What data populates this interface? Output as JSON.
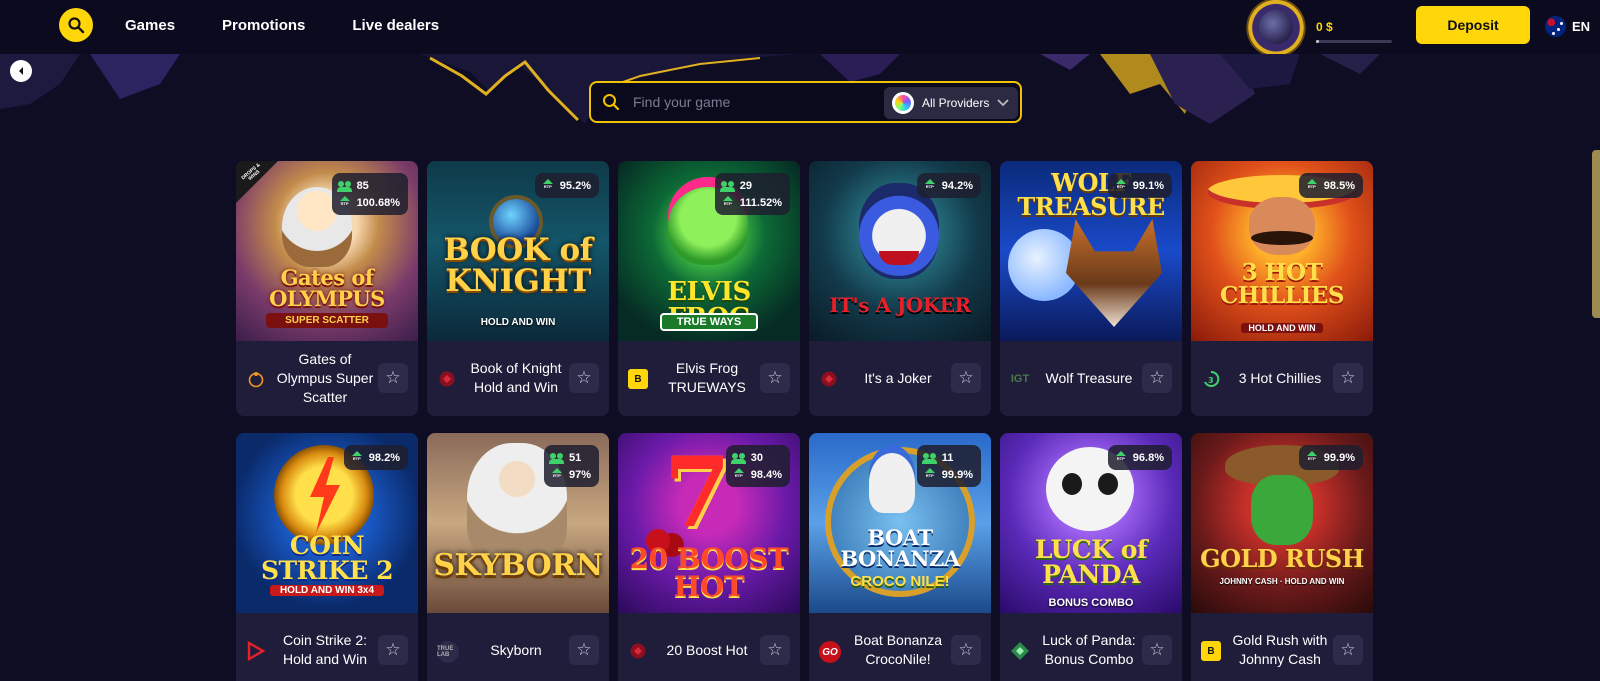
{
  "nav": {
    "items": [
      "Games",
      "Promotions",
      "Live dealers"
    ]
  },
  "account": {
    "balance": "0 $",
    "deposit_label": "Deposit",
    "language": "EN"
  },
  "search": {
    "placeholder": "Find your game",
    "providers_label": "All Providers"
  },
  "colors": {
    "accent": "#ffd60a",
    "background": "#0e0d24",
    "card": "#1f1d3a",
    "stat_green": "#3fd26b"
  },
  "games": [
    {
      "name": "Gates of Olympus Super Scatter",
      "players": "85",
      "rtp": "100.68%",
      "provider_icon": "pragmatic-play-icon",
      "art_title": "Gates of OLYMPUS",
      "art_sub": "SUPER SCATTER",
      "badge": "DROPS & WINS"
    },
    {
      "name": "Book of Knight Hold and Win",
      "players": "",
      "rtp": "95.2%",
      "provider_icon": "red-provider-icon",
      "art_title": "BOOK of KNIGHT",
      "art_sub": "HOLD AND WIN"
    },
    {
      "name": "Elvis Frog TRUEWAYS",
      "players": "29",
      "rtp": "111.52%",
      "provider_icon": "bgaming-icon",
      "art_title": "ELVIS FROG",
      "art_sub": "TRUE WAYS"
    },
    {
      "name": "It's a Joker",
      "players": "",
      "rtp": "94.2%",
      "provider_icon": "red-provider-icon",
      "art_title": "IT's A JOKER",
      "art_sub": ""
    },
    {
      "name": "Wolf Treasure",
      "players": "",
      "rtp": "99.1%",
      "provider_icon": "igt-icon",
      "art_title": "WOLF TREASURE",
      "art_sub": ""
    },
    {
      "name": "3 Hot Chillies",
      "players": "",
      "rtp": "98.5%",
      "provider_icon": "3-oaks-icon",
      "art_title": "3 HOT CHILLIES",
      "art_sub": "HOLD AND WIN"
    },
    {
      "name": "Coin Strike 2: Hold and Win",
      "players": "",
      "rtp": "98.2%",
      "provider_icon": "playson-icon",
      "art_title": "COIN STRIKE 2",
      "art_sub": "HOLD AND WIN 3x4"
    },
    {
      "name": "Skyborn",
      "players": "51",
      "rtp": "97%",
      "provider_icon": "true-lab-icon",
      "art_title": "SKYBORN",
      "art_sub": ""
    },
    {
      "name": "20 Boost Hot",
      "players": "30",
      "rtp": "98.4%",
      "provider_icon": "red-provider-icon",
      "art_title": "20 BOOST HOT",
      "art_sub": ""
    },
    {
      "name": "Boat Bonanza CrocoNile!",
      "players": "11",
      "rtp": "99.9%",
      "provider_icon": "go-provider-icon",
      "art_title": "BOAT BONANZA",
      "art_sub": "CROCO NILE!"
    },
    {
      "name": "Luck of Panda: Bonus Combo",
      "players": "",
      "rtp": "96.8%",
      "provider_icon": "diamond-provider-icon",
      "art_title": "LUCK of PANDA",
      "art_sub": "BONUS COMBO"
    },
    {
      "name": "Gold Rush with Johnny Cash",
      "players": "",
      "rtp": "99.9%",
      "provider_icon": "bgaming-icon",
      "art_title": "GOLD RUSH",
      "art_sub": "JOHNNY CASH · HOLD AND WIN"
    }
  ]
}
